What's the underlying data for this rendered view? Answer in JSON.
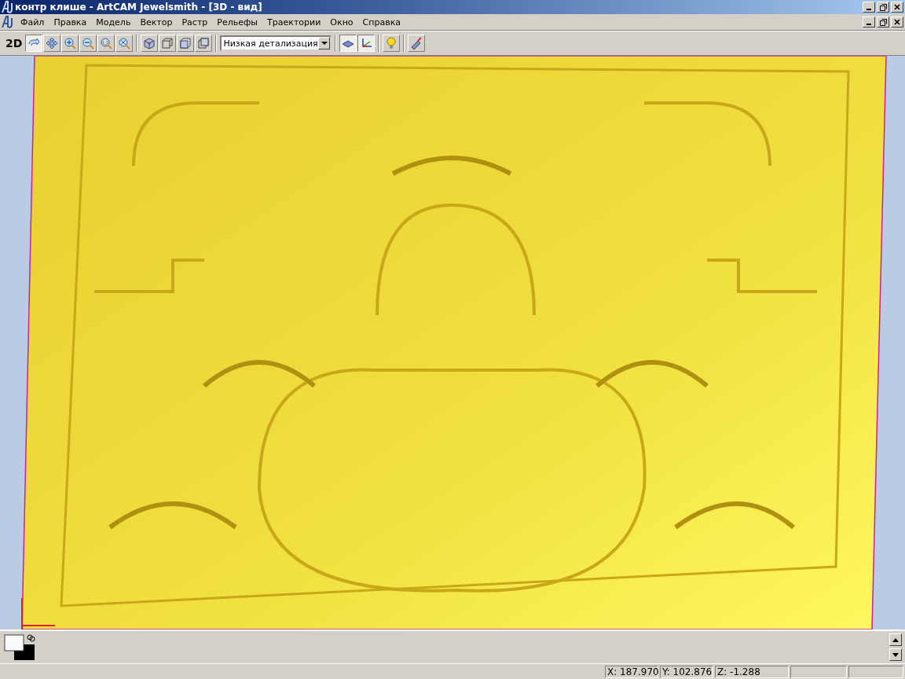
{
  "window": {
    "title": "контр клише - ArtCAM Jewelsmith - [3D - вид]"
  },
  "menu": [
    "Файл",
    "Правка",
    "Модель",
    "Вектор",
    "Растр",
    "Рельефы",
    "Траектории",
    "Окно",
    "Справка"
  ],
  "toolbar": {
    "label": "2D",
    "tools": [
      {
        "kind": "select",
        "pressed": true
      },
      {
        "kind": "pan",
        "pressed": false
      },
      {
        "kind": "zoom-in",
        "pressed": false
      },
      {
        "kind": "zoom-out",
        "pressed": false
      },
      {
        "kind": "zoom-previous",
        "pressed": false
      },
      {
        "kind": "zoom-fit",
        "pressed": false
      },
      {
        "kind": "separator"
      },
      {
        "kind": "cube-iso",
        "pressed": false
      },
      {
        "kind": "cube-wire",
        "pressed": false
      },
      {
        "kind": "cube-front",
        "pressed": false
      },
      {
        "kind": "cube-back",
        "pressed": false
      },
      {
        "kind": "separator"
      },
      {
        "kind": "dropdown"
      },
      {
        "kind": "separator"
      },
      {
        "kind": "plane",
        "pressed": true
      },
      {
        "kind": "axes",
        "pressed": true
      },
      {
        "kind": "separator"
      },
      {
        "kind": "bulb",
        "pressed": false
      },
      {
        "kind": "separator"
      },
      {
        "kind": "brush",
        "pressed": false
      }
    ],
    "detail": {
      "value": "Низкая детализация"
    }
  },
  "status_bar": [
    "X: 187.970",
    "Y: 102.876",
    "Z: -1.288"
  ]
}
